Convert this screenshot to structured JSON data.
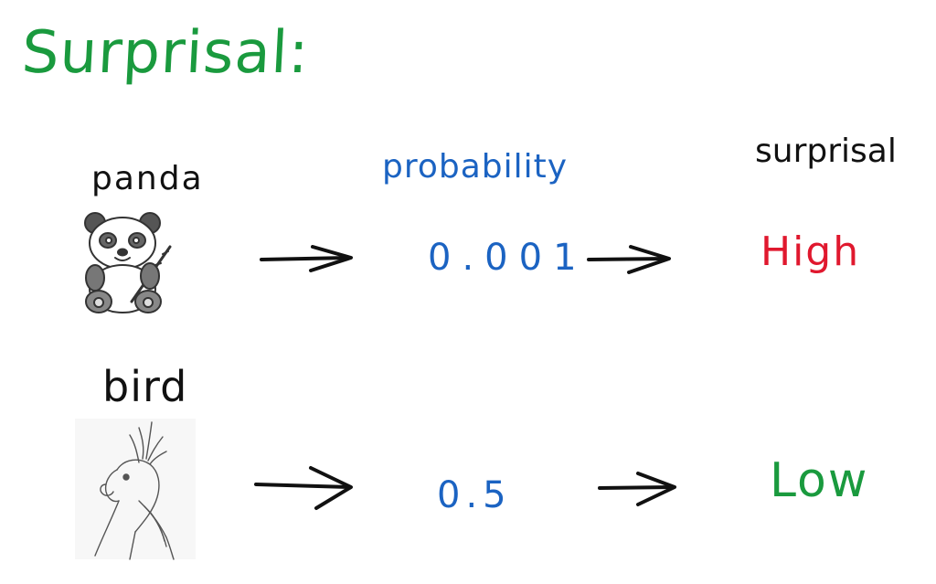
{
  "title": "Surprisal:",
  "columns": {
    "probability": "probability",
    "surprisal": "surprisal"
  },
  "rows": [
    {
      "label": "panda",
      "probability": "0.001",
      "surprisal": "High",
      "image": "panda-icon"
    },
    {
      "label": "bird",
      "probability": "0.5",
      "surprisal": "Low",
      "image": "cockatoo-icon"
    }
  ],
  "colors": {
    "title": "#1a9a3e",
    "probability": "#1b63c2",
    "high": "#e0182e",
    "low": "#1a9a3e",
    "ink": "#111111"
  }
}
